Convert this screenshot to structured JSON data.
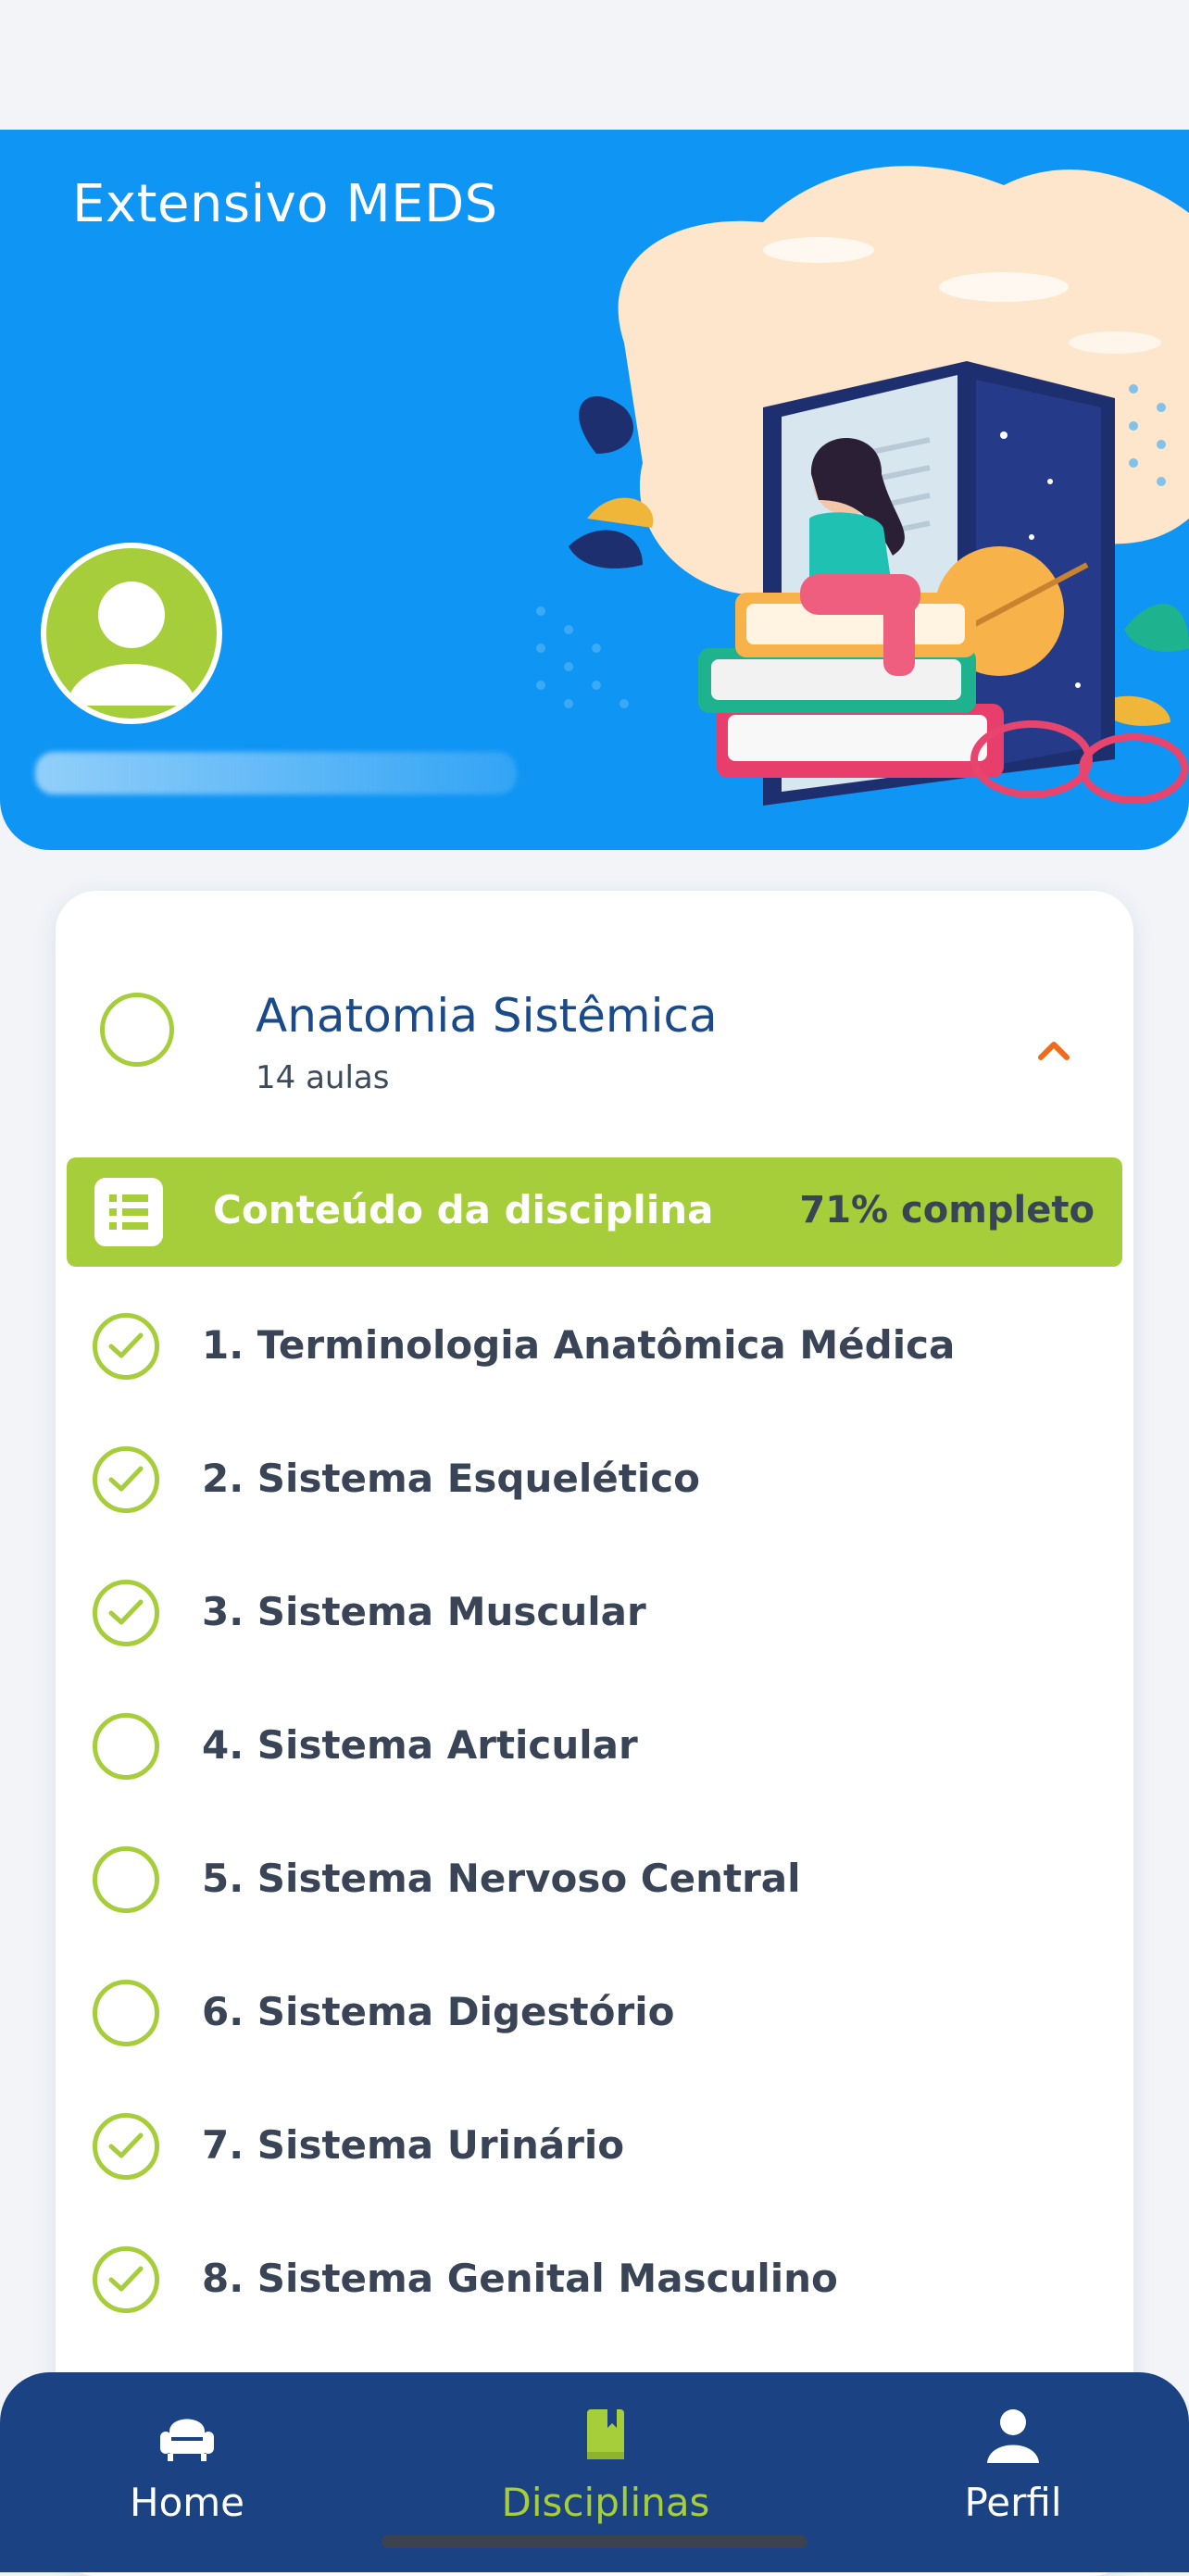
{
  "header": {
    "course_title": "Extensivo MEDS",
    "user_name_blurred": true
  },
  "discipline": {
    "title": "Anatomia Sistêmica",
    "subtitle": "14 aulas",
    "content_bar": {
      "label": "Conteúdo da disciplina",
      "progress": "71% completo"
    },
    "lessons": [
      {
        "label": "1. Terminologia Anatômica Médica",
        "completed": true
      },
      {
        "label": "2. Sistema Esquelético",
        "completed": true
      },
      {
        "label": "3. Sistema Muscular",
        "completed": true
      },
      {
        "label": "4. Sistema Articular",
        "completed": false
      },
      {
        "label": "5. Sistema Nervoso Central",
        "completed": false
      },
      {
        "label": "6. Sistema Digestório",
        "completed": false
      },
      {
        "label": "7. Sistema Urinário",
        "completed": true
      },
      {
        "label": "8. Sistema Genital Masculino",
        "completed": true
      }
    ]
  },
  "nav": {
    "home": "Home",
    "disciplinas": "Disciplinas",
    "perfil": "Perfil",
    "active": "disciplinas"
  },
  "colors": {
    "primary_blue": "#0f95f4",
    "accent_green": "#a6cd3a",
    "nav_bg": "#1b4384",
    "chevron_orange": "#f06a1a"
  }
}
